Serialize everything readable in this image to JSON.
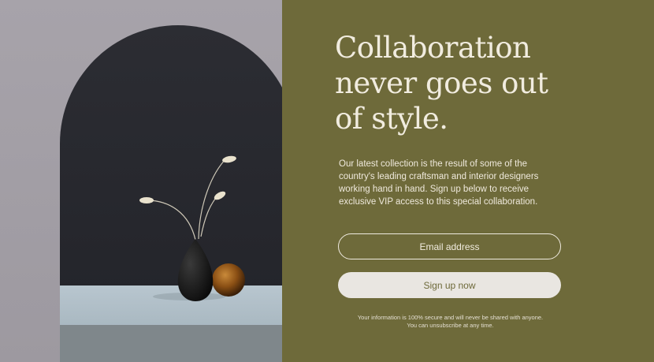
{
  "hero": {
    "headline": "Collaboration never goes out of style.",
    "body": "Our latest collection is the result of some of the country's leading craftsman and interior designers working hand in hand. Sign up below to receive exclusive VIP access to this special collaboration."
  },
  "form": {
    "email_placeholder": "Email address",
    "email_value": "",
    "submit_label": "Sign up now"
  },
  "disclaimer": {
    "line1": "Your information is 100% secure and will never be shared with anyone.",
    "line2": "You can unsubscribe at any time."
  },
  "colors": {
    "panel_bg": "#6e6a3a",
    "text": "#efeadf",
    "button_bg": "#e9e6e1",
    "arch": "#2c2d33"
  }
}
